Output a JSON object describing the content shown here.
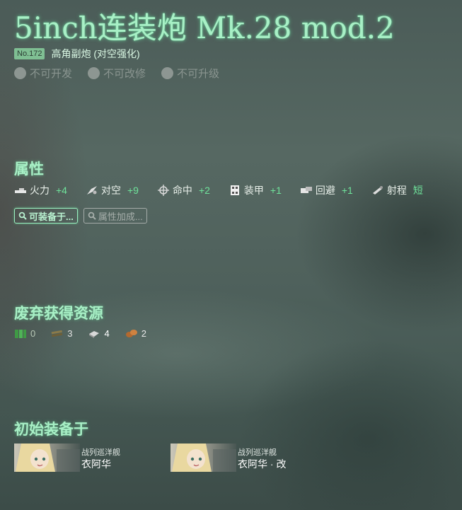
{
  "equipment": {
    "name": "5inch连装炮 Mk.28 mod.2",
    "number": "No.172",
    "type": "高角副炮 (对空强化)",
    "flags": [
      {
        "label": "不可开发"
      },
      {
        "label": "不可改修"
      },
      {
        "label": "不可升级"
      }
    ]
  },
  "sections": {
    "stats_title": "属性",
    "scrap_title": "废弃获得资源",
    "initial_title": "初始装备于"
  },
  "stats": [
    {
      "icon": "firepower-icon",
      "label": "火力",
      "value": "+4"
    },
    {
      "icon": "antiair-icon",
      "label": "对空",
      "value": "+9"
    },
    {
      "icon": "accuracy-icon",
      "label": "命中",
      "value": "+2"
    },
    {
      "icon": "armor-icon",
      "label": "装甲",
      "value": "+1"
    },
    {
      "icon": "evasion-icon",
      "label": "回避",
      "value": "+1"
    },
    {
      "icon": "range-icon",
      "label": "射程",
      "value": "短"
    }
  ],
  "buttons": {
    "equippable": "可装备于...",
    "bonus": "属性加成..."
  },
  "scrap": [
    {
      "icon": "fuel-icon",
      "value": "0"
    },
    {
      "icon": "ammo-icon",
      "value": "3"
    },
    {
      "icon": "steel-icon",
      "value": "4"
    },
    {
      "icon": "bauxite-icon",
      "value": "2"
    }
  ],
  "ships": [
    {
      "type": "战列巡洋舰",
      "name": "衣阿华"
    },
    {
      "type": "战列巡洋舰",
      "name": "衣阿华 · 改"
    }
  ],
  "colors": {
    "accent": "#a8f0c6",
    "stat_value": "#6fe39b",
    "badge": "#7fbf93"
  }
}
